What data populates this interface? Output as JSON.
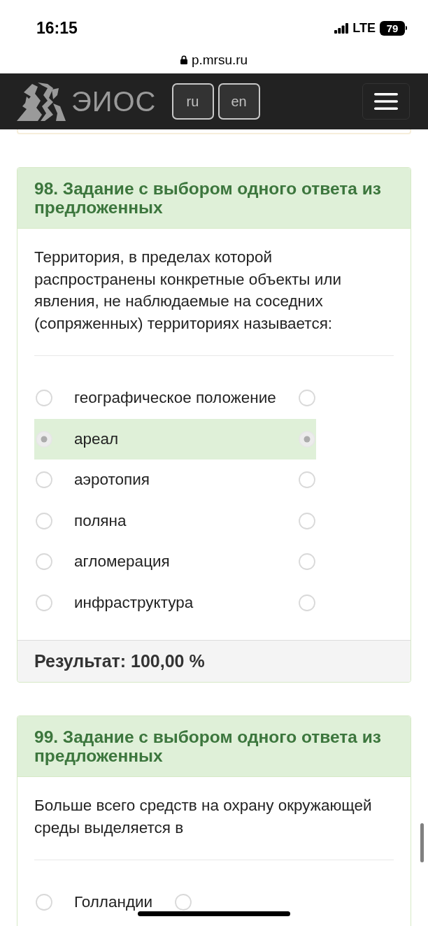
{
  "status_bar": {
    "time": "16:15",
    "network": "LTE",
    "battery": "79"
  },
  "address_bar": {
    "url": "p.mrsu.ru"
  },
  "navbar": {
    "brand": "ЭИОС",
    "languages": [
      "ru",
      "en"
    ]
  },
  "questions": [
    {
      "title": "98. Задание с выбором одного ответа из предложенных",
      "text": "Территория, в пределах которой распространены конкретные объекты или явления, не наблюдаемые на соседних (сопряженных) территориях называется:",
      "options": [
        {
          "label": "географическое положение",
          "selected": false,
          "correct": false
        },
        {
          "label": "ареал",
          "selected": true,
          "correct": true
        },
        {
          "label": "аэротопия",
          "selected": false,
          "correct": false
        },
        {
          "label": "поляна",
          "selected": false,
          "correct": false
        },
        {
          "label": "агломерация",
          "selected": false,
          "correct": false
        },
        {
          "label": "инфраструктура",
          "selected": false,
          "correct": false
        }
      ],
      "result": "Результат: 100,00 %"
    },
    {
      "title": "99. Задание с выбором одного ответа из предложенных",
      "text": "Больше всего средств на охрану окружающей среды выделяется в",
      "options": [
        {
          "label": "Голландии",
          "selected": false,
          "correct": false
        }
      ]
    }
  ]
}
